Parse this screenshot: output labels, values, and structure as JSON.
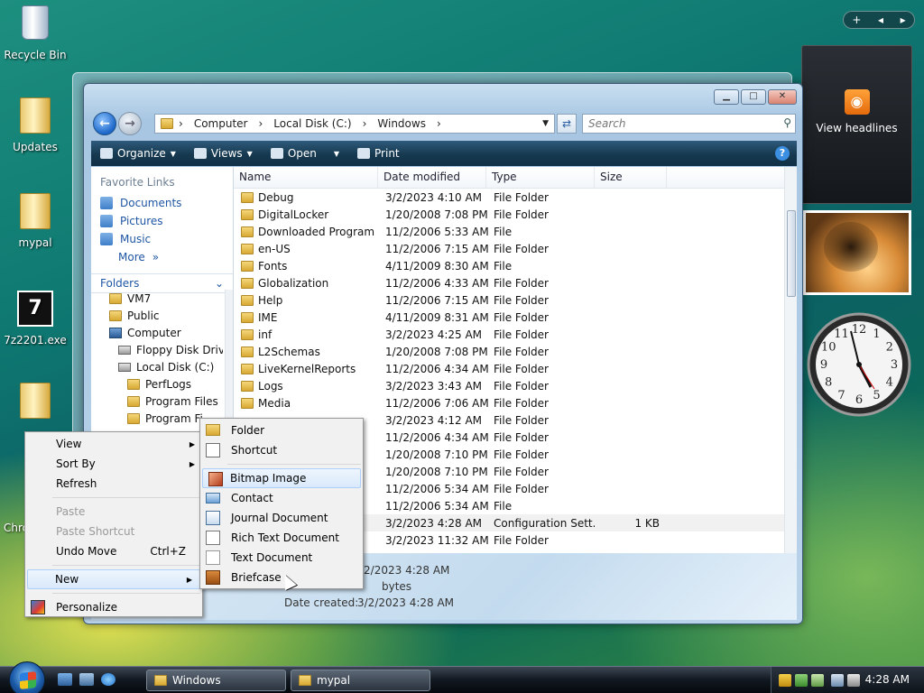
{
  "desktop": {
    "icons": [
      {
        "label": "Recycle Bin",
        "icon": "recycle-bin-icon"
      },
      {
        "label": "Updates",
        "icon": "folder-icon"
      },
      {
        "label": "mypal",
        "icon": "folder-icon"
      },
      {
        "label": "7z2201.exe",
        "icon": "installer-icon"
      },
      {
        "label": "",
        "icon": "folder-icon"
      },
      {
        "label": "Chro",
        "icon": "chrome-icon"
      }
    ]
  },
  "gadgets": {
    "bar_plus": "+",
    "feed_label": "View headlines",
    "clock_numbers": [
      "12",
      "1",
      "2",
      "3",
      "4",
      "5",
      "6",
      "7",
      "8",
      "9",
      "10",
      "11"
    ]
  },
  "explorer": {
    "breadcrumb": [
      "Computer",
      "Local Disk (C:)",
      "Windows"
    ],
    "search_placeholder": "Search",
    "toolbar": {
      "organize": "Organize",
      "views": "Views",
      "open": "Open",
      "print": "Print",
      "help": "?"
    },
    "favorite_links_title": "Favorite Links",
    "favorite_links": [
      "Documents",
      "Pictures",
      "Music"
    ],
    "more": "More",
    "folders_title": "Folders",
    "tree": [
      "VM7",
      "Public",
      "Computer",
      "Floppy Disk Drive",
      "Local Disk (C:)",
      "PerfLogs",
      "Program Files",
      "Program Fi..."
    ],
    "columns": [
      "Name",
      "Date modified",
      "Type",
      "Size"
    ],
    "files": [
      {
        "name": "Debug",
        "date": "3/2/2023 4:10 AM",
        "type": "File Folder",
        "size": ""
      },
      {
        "name": "DigitalLocker",
        "date": "1/20/2008 7:08 PM",
        "type": "File Folder",
        "size": ""
      },
      {
        "name": "Downloaded Program ...",
        "date": "11/2/2006 5:33 AM",
        "type": "File",
        "size": ""
      },
      {
        "name": "en-US",
        "date": "11/2/2006 7:15 AM",
        "type": "File Folder",
        "size": ""
      },
      {
        "name": "Fonts",
        "date": "4/11/2009 8:30 AM",
        "type": "File",
        "size": ""
      },
      {
        "name": "Globalization",
        "date": "11/2/2006 4:33 AM",
        "type": "File Folder",
        "size": ""
      },
      {
        "name": "Help",
        "date": "11/2/2006 7:15 AM",
        "type": "File Folder",
        "size": ""
      },
      {
        "name": "IME",
        "date": "4/11/2009 8:31 AM",
        "type": "File Folder",
        "size": ""
      },
      {
        "name": "inf",
        "date": "3/2/2023 4:25 AM",
        "type": "File Folder",
        "size": ""
      },
      {
        "name": "L2Schemas",
        "date": "1/20/2008 7:08 PM",
        "type": "File Folder",
        "size": ""
      },
      {
        "name": "LiveKernelReports",
        "date": "11/2/2006 4:34 AM",
        "type": "File Folder",
        "size": ""
      },
      {
        "name": "Logs",
        "date": "3/2/2023 3:43 AM",
        "type": "File Folder",
        "size": ""
      },
      {
        "name": "Media",
        "date": "11/2/2006 7:06 AM",
        "type": "File Folder",
        "size": ""
      },
      {
        "name": "",
        "date": "3/2/2023 4:12 AM",
        "type": "File Folder",
        "size": ""
      },
      {
        "name": "",
        "date": "11/2/2006 4:34 AM",
        "type": "File Folder",
        "size": ""
      },
      {
        "name": "",
        "date": "1/20/2008 7:10 PM",
        "type": "File Folder",
        "size": ""
      },
      {
        "name": "",
        "date": "1/20/2008 7:10 PM",
        "type": "File Folder",
        "size": ""
      },
      {
        "name": "",
        "date": "11/2/2006 5:34 AM",
        "type": "File Folder",
        "size": ""
      },
      {
        "name": "",
        "date": "11/2/2006 5:34 AM",
        "type": "File",
        "size": ""
      },
      {
        "name": "",
        "date": "3/2/2023 4:28 AM",
        "type": "Configuration Sett...",
        "size": "1 KB"
      },
      {
        "name": "",
        "date": "3/2/2023 11:32 AM",
        "type": "File Folder",
        "size": ""
      }
    ],
    "details": {
      "modified": "/2/2023 4:28 AM",
      "size": "bytes",
      "created_label": "Date created:",
      "created_value": "3/2/2023 4:28 AM"
    }
  },
  "desktop_menu": {
    "items": [
      {
        "label": "View",
        "submenu": true
      },
      {
        "label": "Sort By",
        "submenu": true
      },
      {
        "label": "Refresh"
      },
      {
        "label": "Paste",
        "disabled": true
      },
      {
        "label": "Paste Shortcut",
        "disabled": true
      },
      {
        "label": "Undo Move",
        "shortcut": "Ctrl+Z"
      },
      {
        "label": "New",
        "submenu": true
      },
      {
        "label": "Personalize"
      }
    ]
  },
  "new_submenu": {
    "items": [
      "Folder",
      "Shortcut",
      "Bitmap Image",
      "Contact",
      "Journal Document",
      "Rich Text Document",
      "Text Document",
      "Briefcase"
    ]
  },
  "taskbar": {
    "buttons": [
      "Windows",
      "mypal"
    ],
    "time": "4:28 AM"
  },
  "colors": {
    "toolbar": "#16394f",
    "link": "#1f56a3",
    "menu_highlight": "#d9e9fb"
  }
}
